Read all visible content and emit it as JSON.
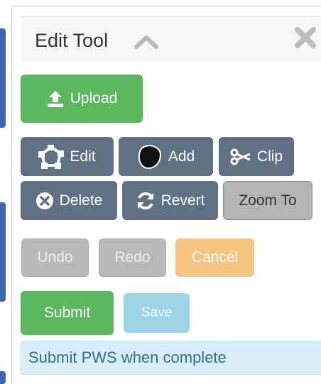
{
  "panel": {
    "title": "Edit Tool"
  },
  "buttons": {
    "upload": "Upload",
    "edit": "Edit",
    "add": "Add",
    "clip": "Clip",
    "delete": "Delete",
    "revert": "Revert",
    "zoom_to": "Zoom To",
    "undo": "Undo",
    "redo": "Redo",
    "cancel": "Cancel",
    "submit": "Submit",
    "save": "Save"
  },
  "status": {
    "message": "Submit PWS when complete"
  },
  "icons": {
    "collapse": "chevron-up-icon",
    "close": "close-icon",
    "upload": "upload-icon",
    "edit": "edit-vertices-icon",
    "add": "polygon-add-icon",
    "clip": "scissors-icon",
    "delete": "times-circle-icon",
    "revert": "refresh-icon"
  },
  "colors": {
    "primary_green": "#5cb85c",
    "slate": "#607183",
    "disabled_grey": "#b9b9b9",
    "cancel_orange": "#f5c582",
    "save_blue": "#9fd3e8",
    "info_bg": "#d9eef8",
    "info_text": "#31708f"
  }
}
